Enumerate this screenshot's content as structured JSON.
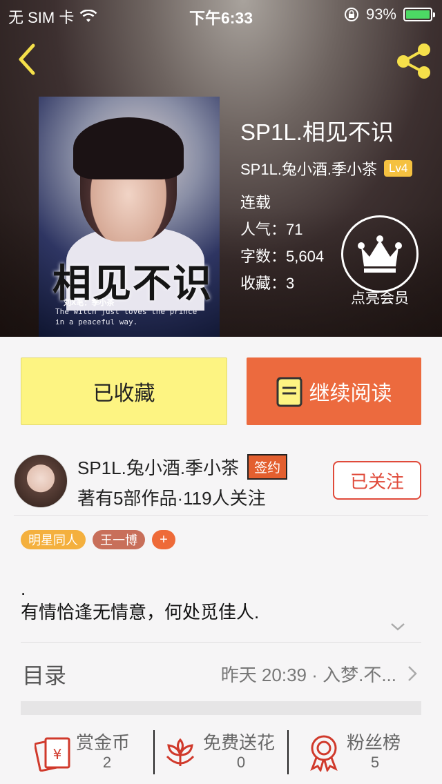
{
  "status_bar": {
    "carrier": "无 SIM 卡",
    "time": "下午6:33",
    "battery": "93%",
    "battery_color": "#4cd964"
  },
  "nav": {
    "back_icon": "chevron-left-icon",
    "share_icon": "share-icon",
    "icon_color": "#f5e04a"
  },
  "book": {
    "title": "SP1L.相见不识",
    "author": "SP1L.兔小酒.季小茶",
    "level": "Lv4",
    "status": "连载",
    "popularity_label": "人气：",
    "popularity": "71",
    "word_count_label": "字数：",
    "word_count": "5,604",
    "favorites_label": "收藏：",
    "favorites": "3",
    "cover": {
      "title": "相见不识",
      "byline": "刘X笔：季小茶",
      "tagline": "The witch just loves the prince in a peaceful way."
    }
  },
  "vip": {
    "label": "点亮会员",
    "icon": "crown-icon"
  },
  "actions": {
    "collected_label": "已收藏",
    "read_label": "继续阅读",
    "read_icon": "book-icon",
    "collected_bg": "#fdf482",
    "read_bg": "#ec6a3e"
  },
  "author_card": {
    "name": "SP1L.兔小酒.季小茶",
    "badge": "签约",
    "stats": "著有5部作品·119人关注",
    "follow_label": "已关注"
  },
  "tags": [
    {
      "label": "明星同人"
    },
    {
      "label": "王一博"
    },
    {
      "label": "+"
    }
  ],
  "description": {
    "line1": ".",
    "line2": "有情恰逢无情意，何处觅佳人."
  },
  "toc": {
    "label": "目录",
    "latest": "昨天 20:39 · 入梦.不..."
  },
  "bottom_bar": [
    {
      "label": "赏金币",
      "count": "2",
      "icon": "red-envelope-icon"
    },
    {
      "label": "免费送花",
      "count": "0",
      "icon": "flower-icon"
    },
    {
      "label": "粉丝榜",
      "count": "5",
      "icon": "medal-icon"
    }
  ]
}
